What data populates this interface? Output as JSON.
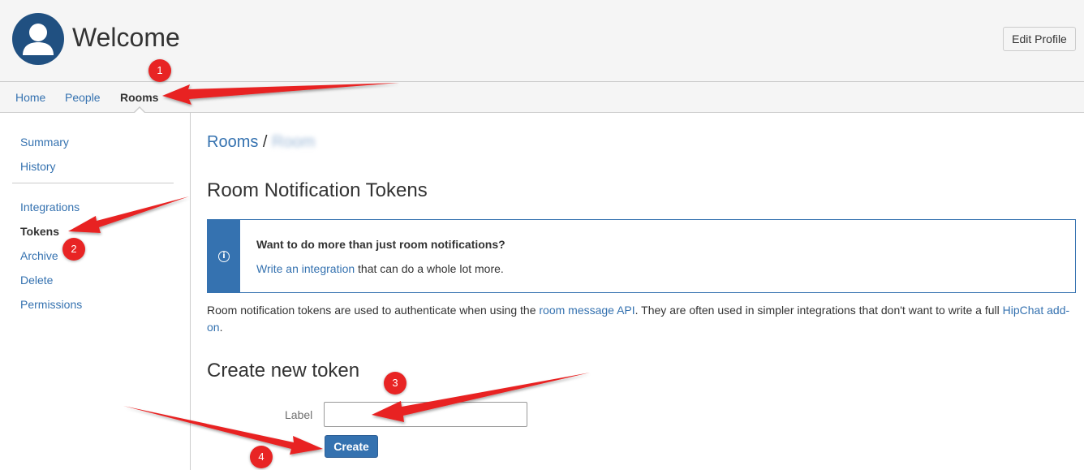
{
  "header": {
    "title": "Welcome",
    "edit_profile_label": "Edit Profile"
  },
  "nav": {
    "items": [
      {
        "label": "Home",
        "active": false
      },
      {
        "label": "People",
        "active": false
      },
      {
        "label": "Rooms",
        "active": true
      }
    ]
  },
  "sidebar": {
    "group1": [
      {
        "label": "Summary",
        "active": false
      },
      {
        "label": "History",
        "active": false
      }
    ],
    "group2": [
      {
        "label": "Integrations",
        "active": false
      },
      {
        "label": "Tokens",
        "active": true
      },
      {
        "label": "Archive",
        "active": false
      },
      {
        "label": "Delete",
        "active": false
      },
      {
        "label": "Permissions",
        "active": false
      }
    ]
  },
  "breadcrumb": {
    "root": "Rooms",
    "separator": "/",
    "current": "Room"
  },
  "main": {
    "title": "Room Notification Tokens",
    "info": {
      "heading": "Want to do more than just room notifications?",
      "link": "Write an integration",
      "text": "that can do a whole lot more."
    },
    "description": {
      "part1": "Room notification tokens are used to authenticate when using the",
      "link1": "room message API",
      "part2": ". They are often used in simpler integrations that don't want to write a full",
      "link2": "HipChat add-on",
      "part3": "."
    },
    "create": {
      "title": "Create new token",
      "label": "Label",
      "input_value": "",
      "button": "Create"
    }
  },
  "annotations": {
    "badges": [
      "1",
      "2",
      "3",
      "4"
    ],
    "color": "#e82424"
  },
  "colors": {
    "link": "#3572b0",
    "header_bg": "#f5f5f5",
    "avatar_bg": "#205081"
  }
}
